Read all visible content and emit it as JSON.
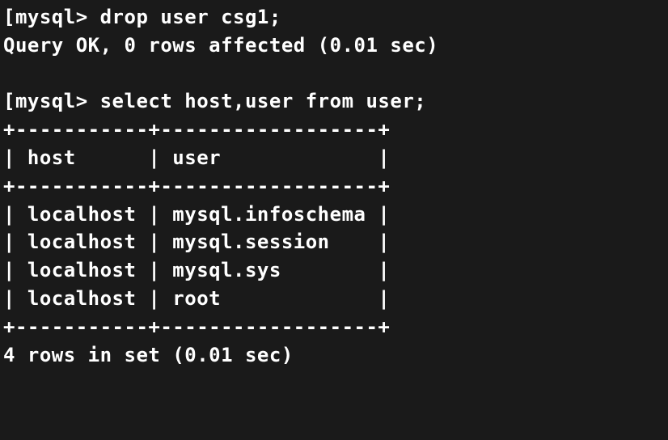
{
  "prompt": "[mysql> ",
  "commands": {
    "drop_user": "drop user csg1;",
    "select": "select host,user from user;"
  },
  "responses": {
    "query_ok": "Query OK, 0 rows affected (0.01 sec)",
    "rows_in_set": "4 rows in set (0.01 sec)"
  },
  "table": {
    "border_top": "+-----------+------------------+",
    "header": "| host      | user             |",
    "border_mid": "+-----------+------------------+",
    "rows": [
      "| localhost | mysql.infoschema |",
      "| localhost | mysql.session    |",
      "| localhost | mysql.sys        |",
      "| localhost | root             |"
    ],
    "border_bot": "+-----------+------------------+"
  },
  "blank": " ",
  "chart_data": {
    "type": "table",
    "headers": [
      "host",
      "user"
    ],
    "rows": [
      [
        "localhost",
        "mysql.infoschema"
      ],
      [
        "localhost",
        "mysql.session"
      ],
      [
        "localhost",
        "mysql.sys"
      ],
      [
        "localhost",
        "root"
      ]
    ]
  }
}
